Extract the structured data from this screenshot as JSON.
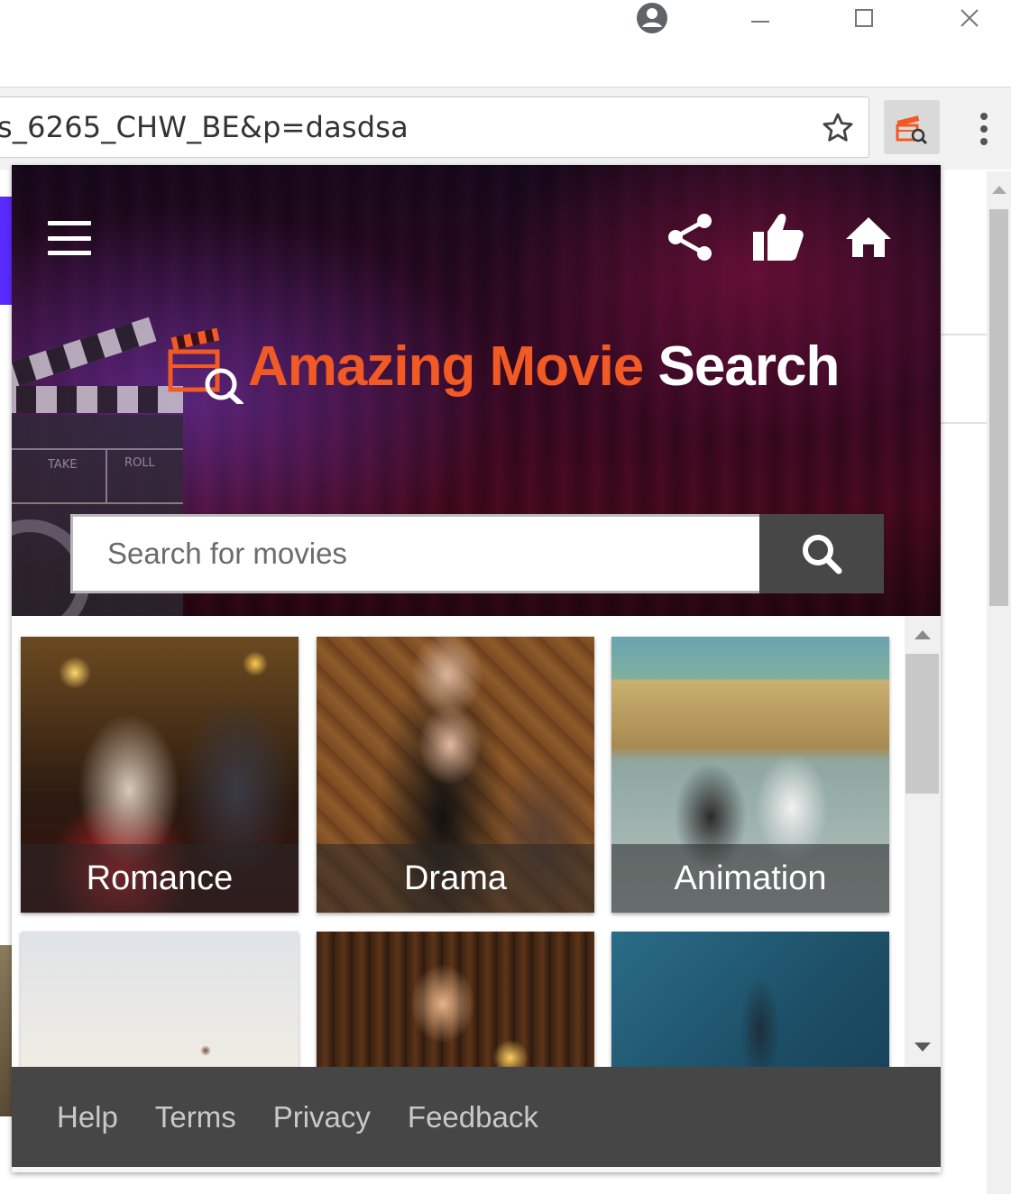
{
  "window": {
    "controls": [
      "profile-icon",
      "minimize-icon",
      "maximize-icon",
      "close-icon"
    ]
  },
  "toolbar": {
    "url": "s_6265_CHW_BE&p=dasdsa",
    "bookmark_icon": "star-icon",
    "extension_icon": "movie-search-icon",
    "menu_icon": "more-vert-icon"
  },
  "popup": {
    "header": {
      "menu_icon": "hamburger-icon",
      "actions": [
        "share-icon",
        "thumbs-up-icon",
        "home-icon"
      ],
      "brand_part1": "Amazing Movie",
      "brand_part2": "Search",
      "brand_color": "#f15a24"
    },
    "search": {
      "placeholder": "Search for movies",
      "value": "",
      "button_icon": "search-icon"
    },
    "genres": [
      {
        "label": "Romance"
      },
      {
        "label": "Drama"
      },
      {
        "label": "Animation"
      },
      {
        "label": ""
      },
      {
        "label": ""
      },
      {
        "label": ""
      }
    ],
    "footer": {
      "links": [
        "Help",
        "Terms",
        "Privacy",
        "Feedback"
      ]
    }
  }
}
